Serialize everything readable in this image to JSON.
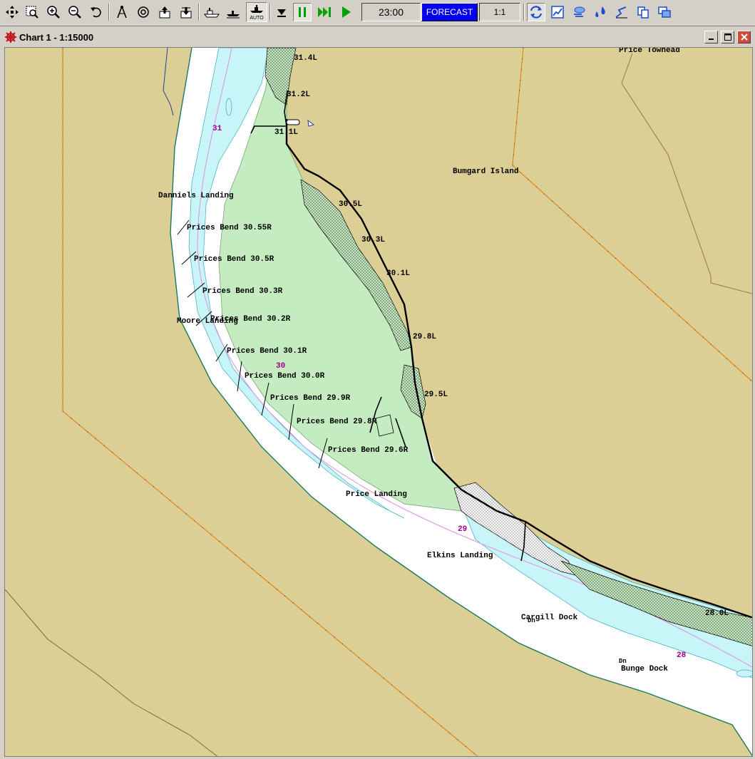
{
  "toolbar": {
    "time": "23:00",
    "forecast_label": "FORECAST",
    "scale_ratio": "1:1",
    "auto_label": "AUTO",
    "colors": {
      "forecast_bg": "#0000ee",
      "play": "#00a000"
    }
  },
  "window": {
    "title": "Chart 1 - 1:15000",
    "icon": "ship-wheel-icon"
  },
  "chart": {
    "colors": {
      "land": "#dccf95",
      "water": "#ffffff",
      "shallow": "#c8f5f8",
      "island": "#c4ecc0",
      "mile_marker": "#a0008a"
    },
    "places": {
      "price_towhead": "Price Towhead",
      "bumgard_island": "Bumgard Island",
      "danniels_landing": "Danniels Landing",
      "moore_landing": "Moore Landing",
      "price_landing": "Price Landing",
      "elkins_landing": "Elkins Landing",
      "cargill_dock": "Cargill Dock",
      "bunge_dock": "Bunge Dock",
      "dn_1": "Dn",
      "dn_2": "Dn"
    },
    "right_bank": [
      "Prices Bend 30.55R",
      "Prices Bend 30.5R",
      "Prices Bend 30.3R",
      "Prices Bend 30.2R",
      "Prices Bend 30.1R",
      "Prices Bend 30.0R",
      "Prices Bend 29.9R",
      "Prices Bend 29.8R",
      "Prices Bend 29.6R"
    ],
    "left_bank": [
      "31.4L",
      "31.2L",
      "31.1L",
      "30.5L",
      "30.3L",
      "30.1L",
      "29.8L",
      "29.5L",
      "28.0L"
    ],
    "miles": [
      "31",
      "30",
      "29",
      "28"
    ]
  }
}
